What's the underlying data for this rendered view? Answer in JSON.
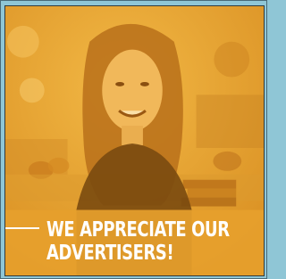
{
  "ad": {
    "headline_line1": "WE APPRECIATE OUR",
    "headline_line2": "ADVERTISERS!"
  },
  "colors": {
    "overlay": "#e9a331",
    "frame": "#8fc6d6",
    "text": "#ffffff"
  }
}
